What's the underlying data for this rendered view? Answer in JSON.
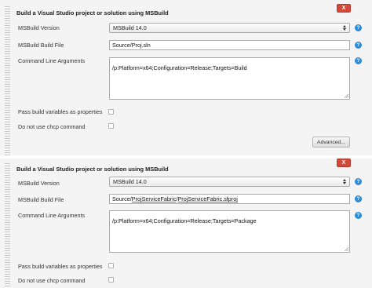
{
  "sections": [
    {
      "title": "Build a Visual Studio project or solution using MSBuild",
      "delete_label": "X",
      "msbuild_version_label": "MSBuild Version",
      "msbuild_version_value": "MSBuild 14.0",
      "build_file_label": "MSBuild Build File",
      "build_file_value": "Source/Proj.sln",
      "cmd_args_label": "Command Line Arguments",
      "cmd_args_value": "/p:Platform=x64;Configuration=Release;Targets=Build",
      "pass_vars_label": "Pass build variables as properties",
      "pass_vars_checked": false,
      "no_chcp_label": "Do not use chcp command",
      "no_chcp_checked": false,
      "advanced_label": "Advanced..."
    },
    {
      "title": "Build a Visual Studio project or solution using MSBuild",
      "delete_label": "X",
      "msbuild_version_label": "MSBuild Version",
      "msbuild_version_value": "MSBuild 14.0",
      "build_file_label": "MSBuild Build File",
      "build_file_value_prefix": "Source/",
      "build_file_value_part1": "ProjServiceFabric",
      "build_file_value_sep": "/",
      "build_file_value_part2": "ProjServiceFabric.sfproj",
      "cmd_args_label": "Command Line Arguments",
      "cmd_args_value": "/p:Platform=x64;Configuration=Release;Targets=Package",
      "pass_vars_label": "Pass build variables as properties",
      "pass_vars_checked": false,
      "no_chcp_label": "Do not use chcp command",
      "no_chcp_checked": false
    }
  ],
  "help_icon_glyph": "?",
  "colors": {
    "delete_button": "#d24939",
    "help_icon": "#2d8bd8",
    "section_background": "#f4f4f4"
  }
}
